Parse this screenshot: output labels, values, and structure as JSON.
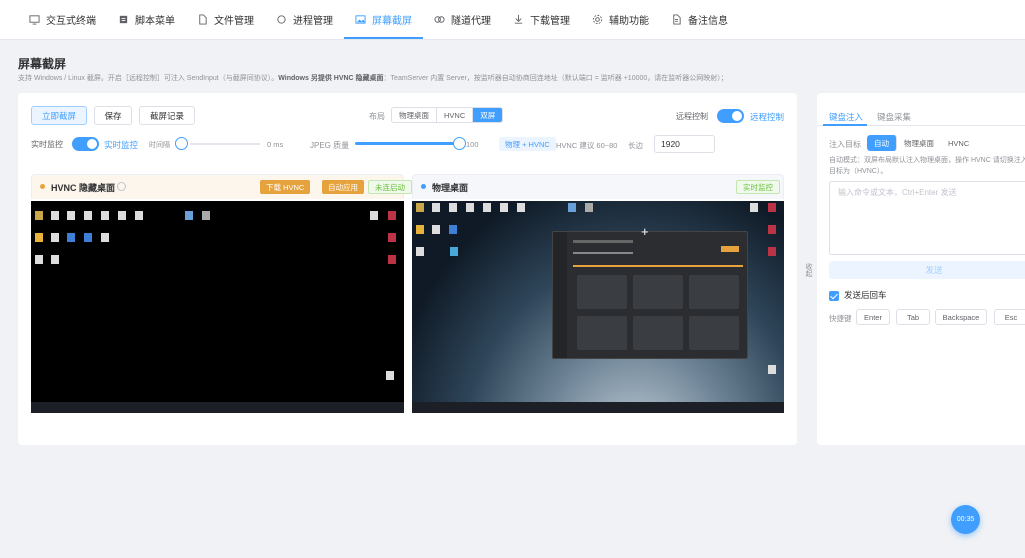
{
  "nav": {
    "tabs": [
      {
        "label": "交互式终端",
        "icon": "terminal-icon"
      },
      {
        "label": "脚本菜单",
        "icon": "script-icon"
      },
      {
        "label": "文件管理",
        "icon": "file-icon"
      },
      {
        "label": "进程管理",
        "icon": "process-icon"
      },
      {
        "label": "屏幕截屏",
        "icon": "image-icon",
        "active": true
      },
      {
        "label": "隧道代理",
        "icon": "tunnel-icon"
      },
      {
        "label": "下载管理",
        "icon": "download-icon"
      },
      {
        "label": "辅助功能",
        "icon": "gear-icon"
      },
      {
        "label": "备注信息",
        "icon": "note-icon"
      }
    ]
  },
  "page": {
    "title": "屏幕截屏",
    "desc_part1": "支持 Windows / Linux 截屏。开启［远程控制］可注入 SendInput（与截屏同协议）。",
    "desc_bold": "Windows 另提供 HVNC 隐藏桌面",
    "desc_part2": "：TeamServer 内置 Server，按监听器自动协商回连地址（默认端口 = 监听器 +10000，请在监听器公网映射）；"
  },
  "toolbar": {
    "capture_now": "立即截屏",
    "save": "保存",
    "history": "截屏记录",
    "layout_label": "布局",
    "layout_options": [
      "物理桌面",
      "HVNC",
      "双屏"
    ],
    "layout_selected": "双屏",
    "remote_control_label": "远程控制",
    "remote_control_active": "远程控制",
    "live_monitor_label": "实时监控",
    "live_monitor_active": "实时监控",
    "interval_label": "时间隔",
    "interval_value": "0 ms",
    "jpeg_label": "JPEG 质量",
    "jpeg_value": "100",
    "jpeg_level": 1.0,
    "mode_tag": "物理 + HVNC",
    "hvnc_hint": "HVNC 建议 60~80",
    "width_label": "长边",
    "width_value": "1920"
  },
  "hvnc_panel": {
    "title": "HVNC 隐藏桌面",
    "start_button": "下载 HVNC",
    "auto_button": "自动应用",
    "status_tag": "未连启动"
  },
  "physical_panel": {
    "title": "物理桌面",
    "status_tag": "实时监控"
  },
  "right": {
    "tabs": [
      "键盘注入",
      "键盘采集"
    ],
    "active_tab": "键盘注入",
    "target_label": "注入目标",
    "targets": [
      "自动",
      "物理桌面",
      "HVNC"
    ],
    "target_selected": "自动",
    "hint": "自动模式：双屏布局默认注入物理桌面，操作 HVNC 请切换注入目标为（HVNC）。",
    "textarea_placeholder": "输入命令或文本，Ctrl+Enter 发送",
    "send_button": "发送",
    "enter_after_label": "发送后回车",
    "shortcut_label": "快捷键",
    "keys": [
      "Enter",
      "Tab",
      "Backspace",
      "Esc"
    ],
    "collapse_label": "收起"
  },
  "fab": {
    "label": "00:35"
  },
  "colors": {
    "accent": "#409eff",
    "orange": "#e6a23c",
    "green": "#67c23a"
  }
}
